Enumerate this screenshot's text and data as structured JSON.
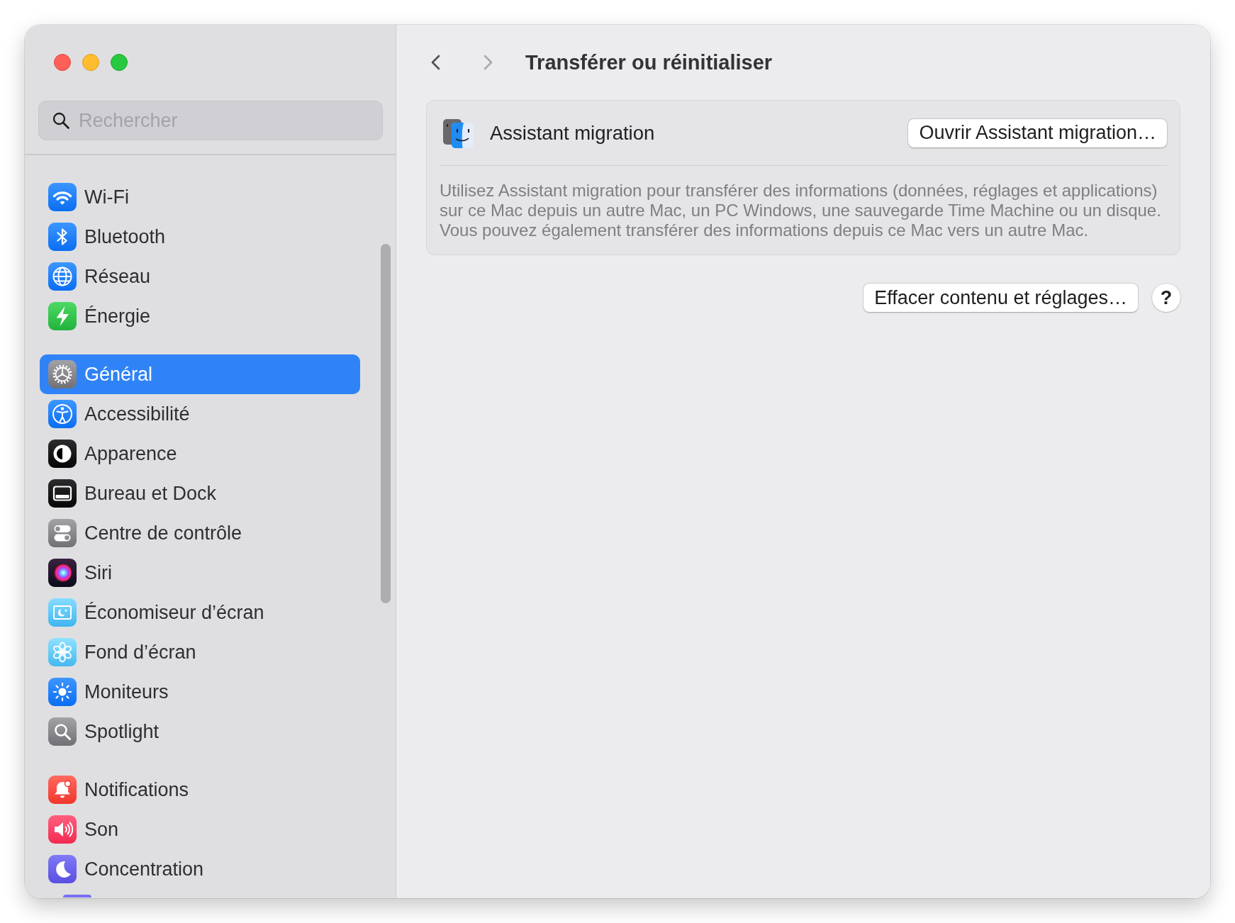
{
  "sidebar": {
    "search": {
      "placeholder": "Rechercher"
    },
    "groups": [
      {
        "items": [
          {
            "label": "Wi-Fi",
            "selected": false
          },
          {
            "label": "Bluetooth",
            "selected": false
          },
          {
            "label": "Réseau",
            "selected": false
          },
          {
            "label": "Énergie",
            "selected": false
          }
        ]
      },
      {
        "items": [
          {
            "label": "Général",
            "selected": true
          },
          {
            "label": "Accessibilité",
            "selected": false
          },
          {
            "label": "Apparence",
            "selected": false
          },
          {
            "label": "Bureau et Dock",
            "selected": false
          },
          {
            "label": "Centre de contrôle",
            "selected": false
          },
          {
            "label": "Siri",
            "selected": false
          },
          {
            "label": "Économiseur d’écran",
            "selected": false
          },
          {
            "label": "Fond d’écran",
            "selected": false
          },
          {
            "label": "Moniteurs",
            "selected": false
          },
          {
            "label": "Spotlight",
            "selected": false
          }
        ]
      },
      {
        "items": [
          {
            "label": "Notifications",
            "selected": false
          },
          {
            "label": "Son",
            "selected": false
          },
          {
            "label": "Concentration",
            "selected": false
          }
        ]
      }
    ]
  },
  "header": {
    "navigation": [
      {
        "kind": "back",
        "disabled": false
      },
      {
        "kind": "forward",
        "disabled": true
      }
    ],
    "title": "Transférer ou réinitialiser"
  },
  "migration": {
    "title": "Assistant migration",
    "button": "Ouvrir Assistant migration…",
    "description": "Utilisez Assistant migration pour transférer des informations (données, réglages et applications) sur ce Mac depuis un autre Mac, un PC Windows, une sauvegarde Time Machine ou un disque. Vous pouvez également transférer des informations depuis ce Mac vers un autre Mac."
  },
  "actions": {
    "erase_button": "Effacer contenu et réglages…",
    "help_button": "?"
  }
}
